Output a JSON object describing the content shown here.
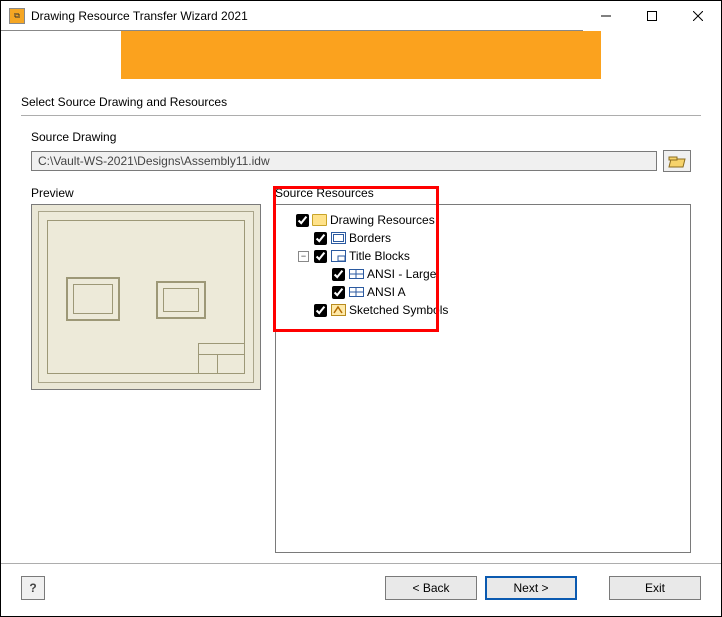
{
  "titlebar": {
    "title": "Drawing Resource Transfer Wizard 2021"
  },
  "step_title": "Select Source Drawing and Resources",
  "source_drawing": {
    "label": "Source Drawing",
    "path": "C:\\Vault-WS-2021\\Designs\\Assembly11.idw"
  },
  "preview": {
    "label": "Preview"
  },
  "resources": {
    "label": "Source Resources",
    "tree": {
      "root": "Drawing Resources",
      "borders": "Borders",
      "title_blocks": "Title Blocks",
      "tb_items": [
        "ANSI - Large",
        "ANSI A"
      ],
      "sketched": "Sketched Symbols"
    }
  },
  "buttons": {
    "back": "< Back",
    "next": "Next >",
    "exit": "Exit"
  }
}
